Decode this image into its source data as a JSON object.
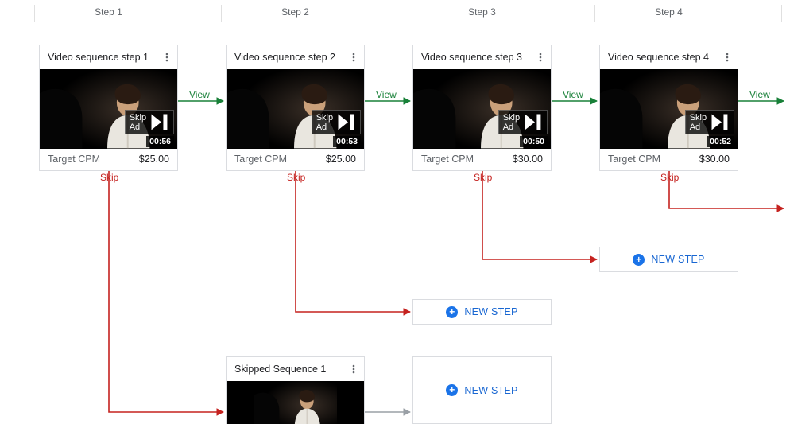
{
  "headers": [
    "Step 1",
    "Step 2",
    "Step 3",
    "Step 4"
  ],
  "labels": {
    "view": "View",
    "skip": "Skip",
    "new_step": "NEW STEP",
    "skip_ad": "Skip Ad",
    "target_cpm": "Target CPM"
  },
  "cards": {
    "s1": {
      "title": "Video sequence step 1",
      "duration": "00:56",
      "price": "$25.00"
    },
    "s2": {
      "title": "Video sequence step 2",
      "duration": "00:53",
      "price": "$25.00"
    },
    "s3": {
      "title": "Video sequence step 3",
      "duration": "00:50",
      "price": "$30.00"
    },
    "s4": {
      "title": "Video sequence step 4",
      "duration": "00:52",
      "price": "$30.00"
    },
    "skipped": {
      "title": "Skipped Sequence 1"
    }
  }
}
